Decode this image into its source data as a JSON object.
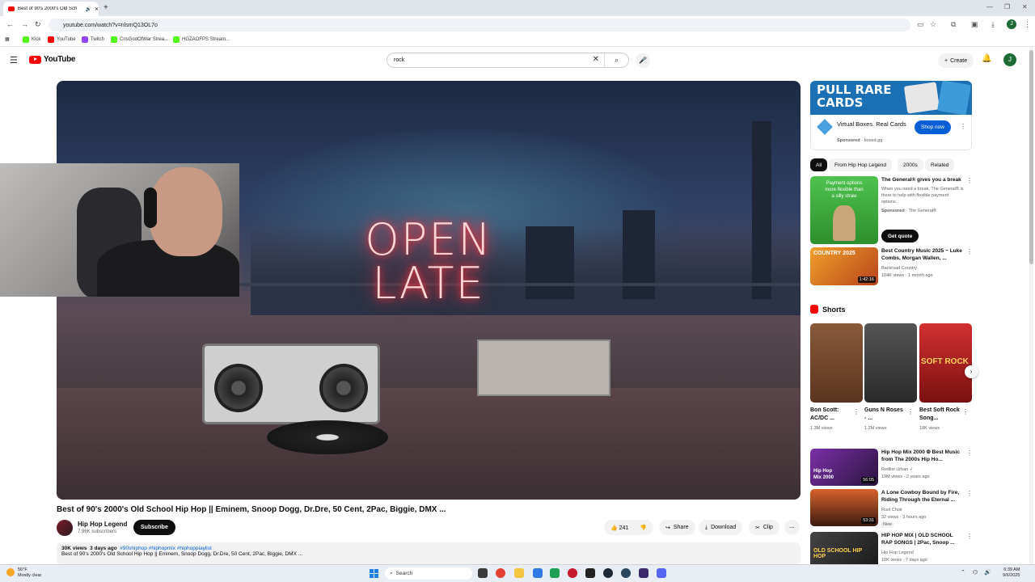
{
  "browser": {
    "tab_title": "Best of 90's 2000's Old Sch",
    "url": "youtube.com/watch?v=nlsmQ13OL7o",
    "bookmarks": [
      {
        "label": "Kick",
        "color": "#53fc18"
      },
      {
        "label": "YouTube",
        "color": "#ff0000"
      },
      {
        "label": "Twitch",
        "color": "#9146ff"
      },
      {
        "label": "CrisGodOfWar Strea...",
        "color": "#53fc18"
      },
      {
        "label": "HGZAOFPS Stream...",
        "color": "#53fc18"
      }
    ],
    "profile_initial": "J"
  },
  "header": {
    "logo_text": "YouTube",
    "search_value": "rock",
    "create_label": "Create",
    "avatar_initial": "J"
  },
  "video": {
    "neon_line1": "OPEN",
    "neon_line2": "LATE",
    "title": "Best of 90's 2000's Old School Hip Hop || Eminem, Snoop Dogg, Dr.Dre, 50 Cent, 2Pac, Biggie, DMX ...",
    "channel": "Hip Hop Legend",
    "subscribers": "7.96K subscribers",
    "subscribe_label": "Subscribe",
    "likes": "241",
    "share_label": "Share",
    "download_label": "Download",
    "clip_label": "Clip",
    "views": "30K views",
    "age": "3 days ago",
    "tags": "#90shiphop #hiphopmix #hiphopplaylist",
    "description": "Best of 90's 2000's Old School Hip Hop || Eminem, Snoop Dogg, Dr.Dre, 50 Cent, 2Pac, Biggie, DMX ..."
  },
  "ad_top": {
    "banner_line1": "PULL RARE",
    "banner_line2": "CARDS",
    "title": "Virtual Boxes. Real Cards",
    "sponsored": "Sponsored",
    "domain": "· boxed.gg",
    "cta": "Shop now"
  },
  "chips": [
    "All",
    "From Hip Hop Legend",
    "2000s",
    "Related"
  ],
  "ad_second": {
    "thumb_line1": "Payment options",
    "thumb_line2": "more flexible than",
    "thumb_line3": "a silly straw",
    "title": "The General® gives you a break",
    "body": "When you need a break, The General® is there to help with flexible payment options.",
    "sponsored": "Sponsored",
    "advertiser": "· The General®",
    "cta": "Get quote"
  },
  "rec1": {
    "thumb_text": "COUNTRY 2025",
    "duration": "1:42:16",
    "title": "Best Country Music 2025 ~ Luke Combs, Morgan Wallen, ...",
    "channel": "Backroad Country",
    "meta": "104K views · 1 month ago"
  },
  "shorts": {
    "heading": "Shorts",
    "items": [
      {
        "title": "Bon Scott: AC/DC ...",
        "views": "1.3M views",
        "color": "#7a4a2e"
      },
      {
        "title": "Guns N Roses - ...",
        "views": "1.2M views",
        "color": "#3a3a3a"
      },
      {
        "title": "Best Soft Rock Song...",
        "views": "18K views",
        "color": "#b32020",
        "overlay": "SOFT ROCK"
      }
    ]
  },
  "recs": [
    {
      "thumb_text": "Hip Hop Mix 2000",
      "duration": "56:05",
      "title": "Hip Hop Mix 2000 ⦾ Best Music from The 2000s Hip Ho...",
      "channel": "Redlist Urban ✓",
      "meta": "19M views · 2 years ago",
      "badge": ""
    },
    {
      "thumb_text": "",
      "duration": "53:31",
      "title": "A Lone Cowboy Bound by Fire, Riding Through the Eternal ...",
      "channel": "Rust Choir",
      "meta": "32 views · 3 hours ago",
      "badge": "New"
    },
    {
      "thumb_text": "OLD SCHOOL HIP HOP",
      "duration": "",
      "title": "HIP HOP MIX | OLD SCHOOL RAP SONGS | 2Pac, Snoop ...",
      "channel": "Hip Hop Legend",
      "meta": "10K views · 7 days ago",
      "badge": ""
    }
  ],
  "taskbar": {
    "temp": "56°F",
    "weather": "Mostly clear",
    "search_label": "Search",
    "time": "6:39 AM",
    "date": "9/6/2025"
  }
}
